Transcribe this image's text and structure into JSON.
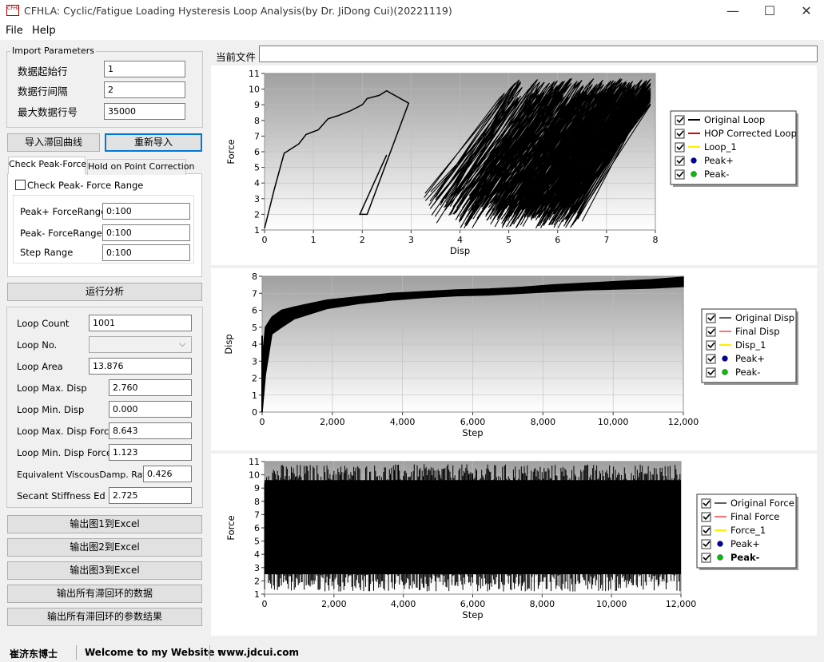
{
  "window": {
    "icon_label": "CFHLA",
    "title": "CFHLA: Cyclic/Fatigue Loading Hysteresis Loop Analysis(by Dr. JiDong Cui)(20221119)",
    "minimize": "—",
    "maximize": "☐",
    "close": "✕"
  },
  "menu": {
    "file": "File",
    "help": "Help"
  },
  "import_params": {
    "title": "Import Parameters",
    "start_row_label": "数据起始行",
    "start_row_value": "1",
    "interval_label": "数据行间隔",
    "interval_value": "2",
    "max_row_label": "最大数据行号",
    "max_row_value": "35000"
  },
  "buttons": {
    "import": "导入滞回曲线",
    "reimport": "重新导入",
    "run": "运行分析",
    "export1": "输出图1到Excel",
    "export2": "输出图2到Excel",
    "export3": "输出图3到Excel",
    "export_all_data": "输出所有滞回环的数据",
    "export_all_params": "输出所有滞回环的参数结果"
  },
  "tabs": {
    "check_peak": "Check Peak-Force",
    "hop": "Hold on Point Correction"
  },
  "check_panel": {
    "check_range_label": "Check Peak- Force Range",
    "peak_plus_label": "Peak+ ForceRange",
    "peak_plus_value": "0:100",
    "peak_minus_label": "Peak- ForceRange",
    "peak_minus_value": "0:100",
    "step_label": "Step Range",
    "step_value": "0:100"
  },
  "results": {
    "loop_count_label": "Loop Count",
    "loop_count": "1001",
    "loop_no_label": "Loop No.",
    "loop_no": "",
    "loop_area_label": "Loop Area",
    "loop_area": "13.876",
    "max_disp_label": "Loop Max. Disp",
    "max_disp": "2.760",
    "min_disp_label": "Loop Min. Disp",
    "min_disp": "0.000",
    "max_disp_force_label": "Loop Max. Disp Force",
    "max_disp_force": "8.643",
    "min_disp_force_label": "Loop Min. Disp Force",
    "min_disp_force": "1.123",
    "evd_label": "Equivalent ViscousDamp. Ratio",
    "evd": "0.426",
    "stiff_label": "Secant Stiffness Ed",
    "stiff": "2.725"
  },
  "file_bar": {
    "label": "当前文件",
    "value": ""
  },
  "status": {
    "author": "崔济东博士",
    "welcome": "Welcome to my Website :",
    "url": "www.jdcui.com"
  },
  "colors": {
    "plot_top": "#a0a0a0",
    "plot_bottom": "#ffffff",
    "accent": "#0078d7"
  },
  "chart_data": [
    {
      "type": "line",
      "xlabel": "Disp",
      "ylabel": "Force",
      "xlim": [
        0,
        8
      ],
      "ylim": [
        1,
        11
      ],
      "x_ticks": [
        "0",
        "1",
        "2",
        "3",
        "4",
        "5",
        "6",
        "7",
        "8"
      ],
      "y_ticks": [
        "1",
        "2",
        "3",
        "4",
        "5",
        "6",
        "7",
        "8",
        "9",
        "10",
        "11"
      ],
      "legend": [
        "Original Loop",
        "HOP Corrected Loop",
        "Loop_1",
        "Peak+",
        "Peak-"
      ],
      "legend_colors": [
        "#000000",
        "#e00000",
        "#ffee00",
        "#0000a0",
        "#00c000"
      ],
      "legend_position": "right",
      "backbone": {
        "x": [
          0,
          0.2,
          0.4,
          0.7,
          0.85,
          1.1,
          1.3,
          1.5,
          1.75,
          2.0,
          2.1,
          2.35,
          2.5,
          2.55
        ],
        "y": [
          1.1,
          3.6,
          5.9,
          6.5,
          7.1,
          7.4,
          8.1,
          8.3,
          8.6,
          9.0,
          9.4,
          9.6,
          9.9,
          9.8
        ]
      }
    },
    {
      "type": "line",
      "xlabel": "Step",
      "ylabel": "Disp",
      "xlim": [
        0,
        13000
      ],
      "ylim": [
        0,
        8
      ],
      "x_ticks": [
        "0",
        "2,000",
        "4,000",
        "6,000",
        "8,000",
        "10,000",
        "12,000"
      ],
      "y_ticks": [
        "0",
        "1",
        "2",
        "3",
        "4",
        "5",
        "6",
        "7",
        "8"
      ],
      "legend": [
        "Original Disp",
        "Final Disp",
        "Disp_1",
        "Peak+",
        "Peak-"
      ],
      "legend_colors": [
        "#606060",
        "#ff7070",
        "#ffee00",
        "#0000a0",
        "#00c000"
      ],
      "legend_position": "right",
      "series_x": [
        0,
        100,
        300,
        600,
        1000,
        1500,
        2000,
        3000,
        4000,
        5000,
        6000,
        7000,
        8000,
        9000,
        10000,
        11000,
        12000,
        13000
      ],
      "series_upper": [
        3,
        5.0,
        5.6,
        6.0,
        6.2,
        6.4,
        6.6,
        6.8,
        7.0,
        7.1,
        7.2,
        7.25,
        7.35,
        7.5,
        7.6,
        7.7,
        7.8,
        7.95
      ],
      "series_lower": [
        0,
        2.2,
        4.6,
        5.0,
        5.5,
        5.8,
        6.1,
        6.4,
        6.6,
        6.75,
        6.85,
        6.9,
        7.0,
        7.1,
        7.2,
        7.25,
        7.3,
        7.4
      ]
    },
    {
      "type": "line",
      "xlabel": "Step",
      "ylabel": "Force",
      "xlim": [
        0,
        13000
      ],
      "ylim": [
        1,
        11
      ],
      "x_ticks": [
        "0",
        "2,000",
        "4,000",
        "6,000",
        "8,000",
        "10,000",
        "12,000"
      ],
      "y_ticks": [
        "1",
        "2",
        "3",
        "4",
        "5",
        "6",
        "7",
        "8",
        "9",
        "10",
        "11"
      ],
      "legend": [
        "Original Force",
        "Final Force",
        "Force_1",
        "Peak+",
        "Peak-"
      ],
      "legend_colors": [
        "#606060",
        "#ff7070",
        "#ffee00",
        "#0000a0",
        "#00c000"
      ],
      "legend_position": "right",
      "series_x": [
        0,
        13000
      ],
      "band_upper": [
        9.5,
        9.5
      ],
      "band_lower": [
        2.5,
        2.5
      ],
      "spike_max": 10.8,
      "spike_min": 1.1
    }
  ]
}
